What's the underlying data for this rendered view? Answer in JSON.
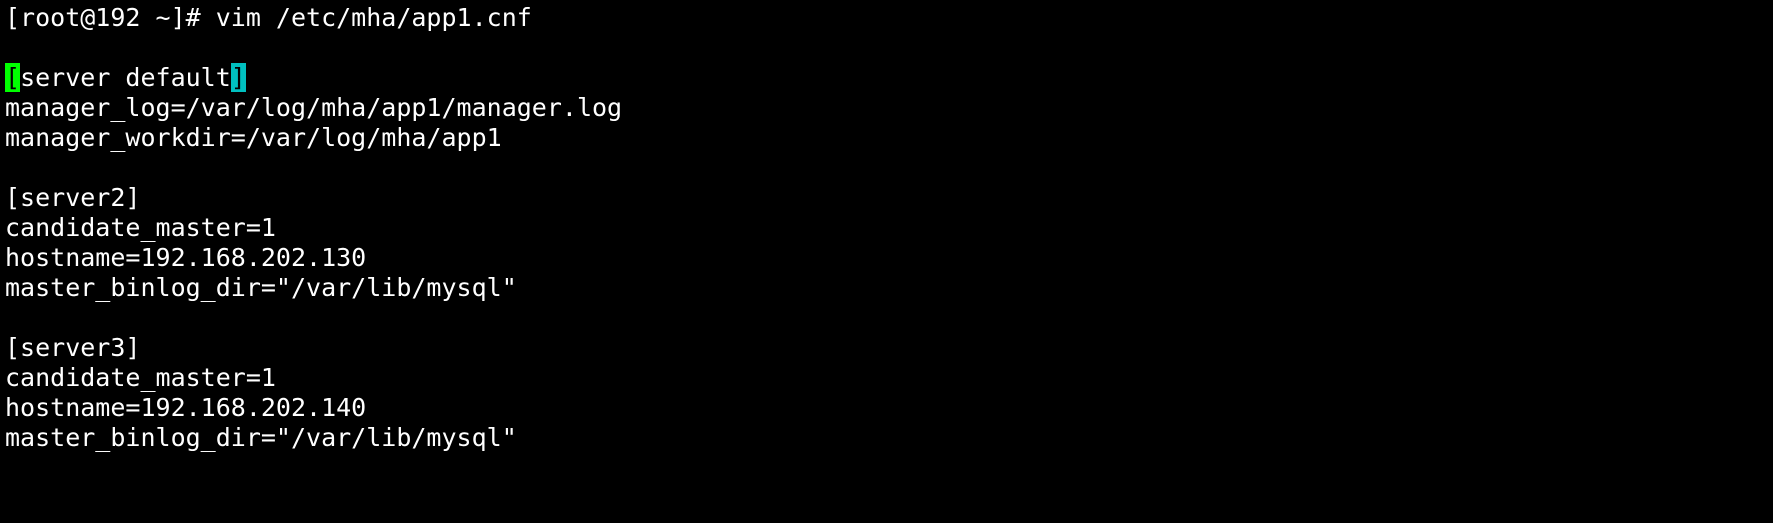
{
  "colors": {
    "background": "#000000",
    "text": "#ffffff",
    "cursor_bracket": "#00ff00",
    "match_bracket": "#00c0c0"
  },
  "prompt": "[root@192 ~]# vim /etc/mha/app1.cnf",
  "section_default": {
    "open_bracket": "[",
    "name": "server default",
    "close_bracket": "]"
  },
  "lines": {
    "manager_log": "manager_log=/var/log/mha/app1/manager.log",
    "manager_workdir": "manager_workdir=/var/log/mha/app1",
    "server2_header": "[server2]",
    "server2_candidate": "candidate_master=1",
    "server2_hostname": "hostname=192.168.202.130",
    "server2_binlog": "master_binlog_dir=\"/var/lib/mysql\"",
    "server3_header": "[server3]",
    "server3_candidate": "candidate_master=1",
    "server3_hostname": "hostname=192.168.202.140",
    "server3_binlog": "master_binlog_dir=\"/var/lib/mysql\""
  }
}
